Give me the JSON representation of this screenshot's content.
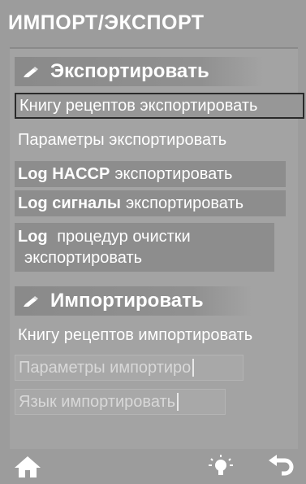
{
  "header": {
    "title": "ИМПОРТ/ЭКСПОРТ"
  },
  "export": {
    "heading": "Экспортировать",
    "items": [
      {
        "label": "Книгу рецептов экспортировать"
      },
      {
        "label": "Параметры экспортировать"
      },
      {
        "bold": "Log HACCP",
        "label": "экспортировать"
      },
      {
        "bold": "Log сигналы",
        "label": "экспортировать"
      },
      {
        "bold": "Log",
        "label": "процедур очистки",
        "label2": "экспортировать"
      }
    ]
  },
  "import": {
    "heading": "Импортировать",
    "items": [
      {
        "label": "Книгу рецептов импортировать"
      },
      {
        "label": "Параметры импортиро"
      },
      {
        "label": "Язык импортировать"
      }
    ]
  },
  "bottom_bar": {
    "icons": [
      "home-icon",
      "lightbulb-icon",
      "back-arrow-icon"
    ]
  },
  "colors": {
    "background": "#9c9c9c",
    "section_header": "#8a8a8a",
    "selection_border": "#2a2a2a",
    "text": "#ffffff"
  }
}
